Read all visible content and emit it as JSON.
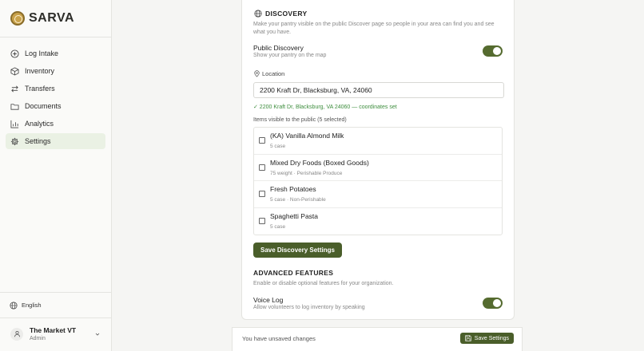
{
  "brand": {
    "name": "SARVA"
  },
  "nav": [
    {
      "label": "Log Intake",
      "icon": "plus-circle-icon"
    },
    {
      "label": "Inventory",
      "icon": "box-icon"
    },
    {
      "label": "Transfers",
      "icon": "transfer-icon"
    },
    {
      "label": "Documents",
      "icon": "folder-icon"
    },
    {
      "label": "Analytics",
      "icon": "chart-icon"
    },
    {
      "label": "Settings",
      "icon": "gear-icon",
      "active": true
    }
  ],
  "sidebar_bottom": {
    "language": "English",
    "account": {
      "name": "The Market VT",
      "role": "Admin"
    }
  },
  "discovery": {
    "title": "DISCOVERY",
    "description": "Make your pantry visible on the public Discover page so people in your area can find you and see what you have.",
    "toggle": {
      "label": "Public Discovery",
      "sub": "Show your pantry on the map",
      "on": true
    },
    "location_label": "Location",
    "location_value": "2200 Kraft Dr, Blacksburg, VA, 24060",
    "coords_status": "✓ 2200 Kraft Dr, Blacksburg, VA 24060 — coordinates set",
    "items_label": "Items visible to the public (5 selected)",
    "items": [
      {
        "name": "(KA) Vanilla Almond Milk",
        "meta": "5 case"
      },
      {
        "name": "Mixed Dry Foods (Boxed Goods)",
        "meta": "75 weight · Perishable Produce"
      },
      {
        "name": "Fresh Potatoes",
        "meta": "5 case · Non-Perishable"
      },
      {
        "name": "Spaghetti Pasta",
        "meta": "5 case"
      }
    ],
    "save_label": "Save Discovery Settings"
  },
  "advanced": {
    "title": "ADVANCED FEATURES",
    "description": "Enable or disable optional features for your organization.",
    "toggle": {
      "label": "Voice Log",
      "sub": "Allow volunteers to log inventory by speaking",
      "on": true
    }
  },
  "footer": {
    "unsaved": "You have unsaved changes",
    "save_label": "Save Settings"
  },
  "colors": {
    "accent": "#4a5e2a",
    "active_nav_bg": "#eaf1e4",
    "success": "#3e8e3e"
  }
}
